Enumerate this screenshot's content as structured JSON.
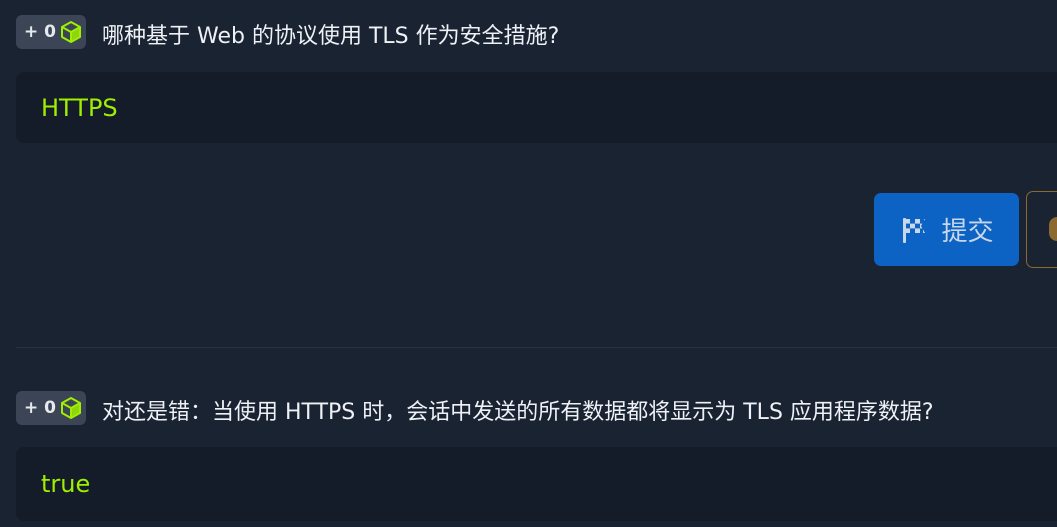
{
  "questions": [
    {
      "points": "+ 0",
      "text": "哪种基于 Web 的协议使用 TLS 作为安全措施?",
      "answer": "HTTPS",
      "submit_label": "提交"
    },
    {
      "points": "+ 0",
      "text": "对还是错：当使用 HTTPS 时，会话中发送的所有数据都将显示为 TLS 应用程序数据?",
      "answer": "true"
    }
  ],
  "colors": {
    "background": "#1a2332",
    "answer_bg": "#141c2a",
    "answer_text": "#9fef00",
    "badge_bg": "#3b4556",
    "submit_bg": "#0d63c3",
    "cube": "#9fef00",
    "hint_border": "#8a6a30"
  },
  "icons": {
    "points_badge": "cube-icon",
    "submit": "flag-checkered-icon",
    "hint": "hint-icon"
  }
}
